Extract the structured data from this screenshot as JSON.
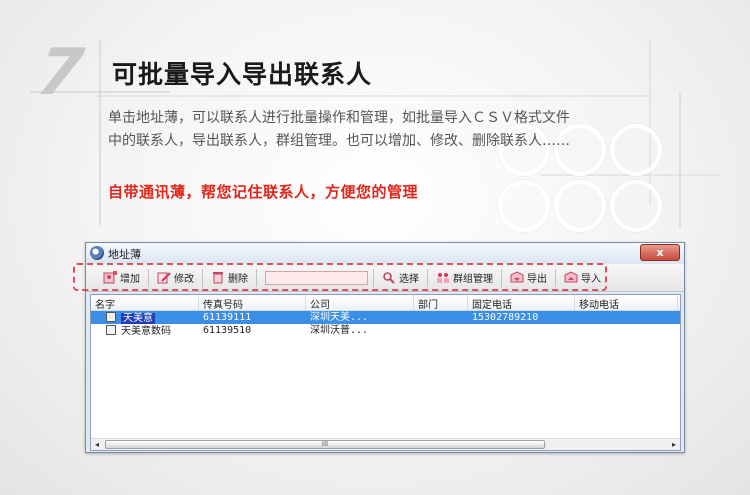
{
  "header": {
    "step_number": "7",
    "title": "可批量导入导出联系人",
    "description_line1": "单击地址薄，可以联系人进行批量操作和管理，如批量导入ＣＳＶ格式文件",
    "description_line2": "中的联系人，导出联系人，群组管理。也可以增加、修改、删除联系人……",
    "slogan": "自带通讯薄，帮您记住联系人，方便您的管理"
  },
  "window": {
    "title": "地址薄",
    "close_label": "x",
    "toolbar": {
      "add_label": "增加",
      "edit_label": "修改",
      "delete_label": "删除",
      "search_value": "",
      "select_label": "选择",
      "group_label": "群组管理",
      "export_label": "导出",
      "import_label": "导入"
    },
    "columns": [
      "名字",
      "传真号码",
      "公司",
      "部门",
      "固定电话",
      "移动电话"
    ],
    "rows": [
      {
        "name": "天美意",
        "fax": "61139111",
        "company": "深圳天美...",
        "dept": "",
        "phone": "15302789210",
        "mobile": ""
      },
      {
        "name": "天美意数码",
        "fax": "61139510",
        "company": "深圳沃普...",
        "dept": "",
        "phone": "",
        "mobile": ""
      }
    ],
    "scrollbar": {
      "left_arrow": "◂",
      "right_arrow": "▸",
      "grip": "III"
    }
  },
  "colors": {
    "slogan": "#e1261c",
    "selection": "#3a8ee6",
    "highlight_frame": "#e0505a"
  },
  "icons": [
    "add-contact-icon",
    "edit-icon",
    "trash-icon",
    "search-icon",
    "group-icon",
    "export-icon",
    "import-icon",
    "contact-card-icon",
    "address-book-icon"
  ]
}
